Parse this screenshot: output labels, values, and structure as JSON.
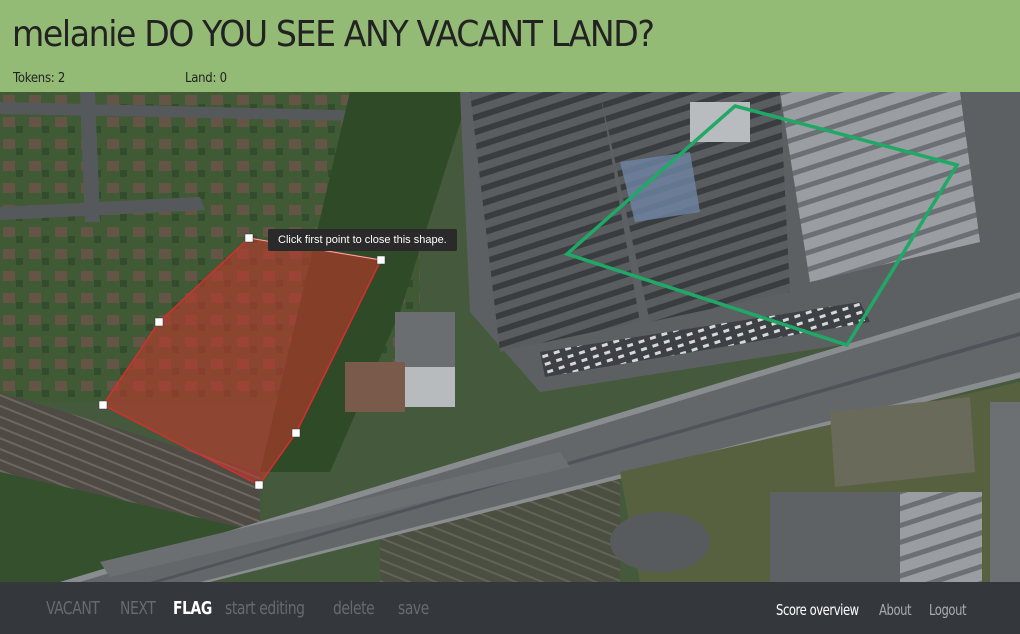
{
  "header": {
    "title": "melanie DO YOU SEE ANY VACANT LAND?",
    "tokens": "Tokens: 2",
    "land": "Land: 0"
  },
  "map": {
    "tooltip": "Click first point to close this shape.",
    "drawn_polygon_color": "#c0392b",
    "existing_polygon_color": "#1fa866"
  },
  "footer": {
    "vacant": "VACANT",
    "next": "NEXT",
    "flag": "FLAG",
    "start_editing": "start editing",
    "delete": "delete",
    "save": "save",
    "score_overview": "Score overview",
    "about": "About",
    "logout": "Logout"
  }
}
